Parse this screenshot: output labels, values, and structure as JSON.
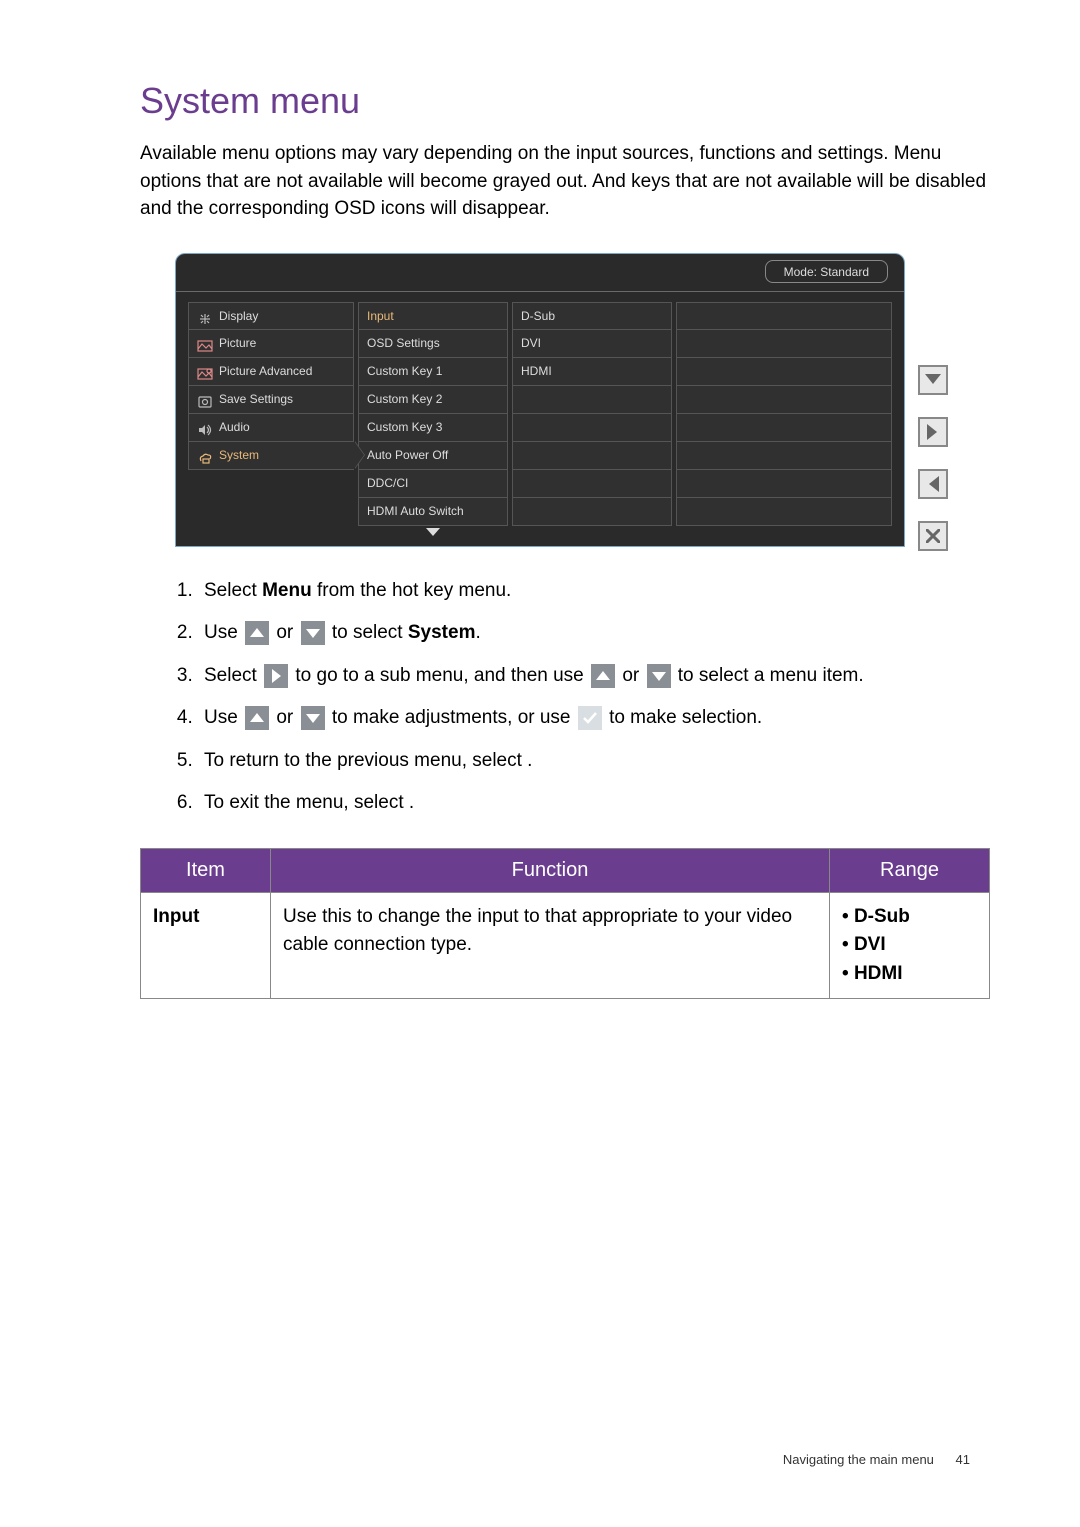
{
  "heading": "System menu",
  "intro": "Available menu options may vary depending on the input sources, functions and settings. Menu options that are not available will become grayed out. And keys that are not available will be disabled and the corresponding OSD icons will disappear.",
  "osd": {
    "mode_label": "Mode: Standard",
    "main_items": [
      {
        "label": "Display",
        "icon": "display-icon",
        "active": false
      },
      {
        "label": "Picture",
        "icon": "picture-icon",
        "active": false
      },
      {
        "label": "Picture Advanced",
        "icon": "picture-adv-icon",
        "active": false
      },
      {
        "label": "Save Settings",
        "icon": "save-icon",
        "active": false
      },
      {
        "label": "Audio",
        "icon": "audio-icon",
        "active": false
      },
      {
        "label": "System",
        "icon": "system-icon",
        "active": true
      }
    ],
    "sub_items": [
      "Input",
      "OSD Settings",
      "Custom Key 1",
      "Custom Key 2",
      "Custom Key 3",
      "Auto Power Off",
      "DDC/CI",
      "HDMI Auto Switch"
    ],
    "sub_active_index": 0,
    "value_items": [
      "D-Sub",
      "DVI",
      "HDMI"
    ]
  },
  "steps": {
    "s1a": "Select ",
    "s1b": "Menu",
    "s1c": " from the hot key menu.",
    "s2a": "Use ",
    "s2b": " or ",
    "s2c": " to select ",
    "s2d": "System",
    "s2e": ".",
    "s3a": "Select ",
    "s3b": " to go to a sub menu, and then use ",
    "s3c": " or ",
    "s3d": " to select a menu item.",
    "s4a": "Use ",
    "s4b": " or ",
    "s4c": " to make adjustments, or use ",
    "s4d": " to make selection.",
    "s5": "To return to the previous menu, select       .",
    "s6": "To exit the menu, select       ."
  },
  "table": {
    "headers": {
      "item": "Item",
      "func": "Function",
      "range": "Range"
    },
    "row": {
      "item": "Input",
      "func": "Use this to change the input to that appropriate to your video cable connection type.",
      "range": [
        "D-Sub",
        "DVI",
        "HDMI"
      ]
    }
  },
  "footer": {
    "text": "Navigating the main menu",
    "page": "41"
  }
}
